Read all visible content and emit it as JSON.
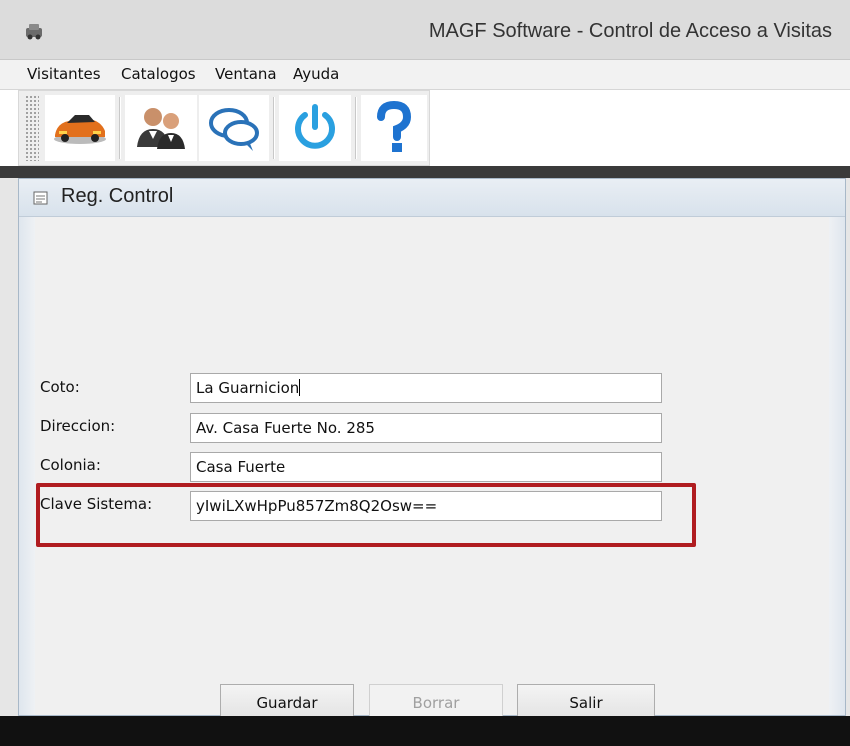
{
  "window": {
    "title": "MAGF Software - Control de Acceso a Visitas"
  },
  "menu": {
    "items": [
      "Visitantes",
      "Catalogos",
      "Ventana",
      "Ayuda"
    ]
  },
  "toolbar": {
    "buttons": [
      {
        "icon": "car-icon"
      },
      {
        "icon": "users-icon"
      },
      {
        "icon": "chat-bubbles-icon"
      },
      {
        "icon": "power-icon"
      },
      {
        "icon": "help-icon"
      }
    ]
  },
  "frame": {
    "title": "Reg. Control"
  },
  "form": {
    "fields": [
      {
        "label": "Coto:",
        "value": "La Guarnicion"
      },
      {
        "label": "Direccion:",
        "value": "Av. Casa Fuerte No. 285"
      },
      {
        "label": "Colonia:",
        "value": "Casa Fuerte"
      },
      {
        "label": "Clave Sistema:",
        "value": "yIwiLXwHpPu857Zm8Q2Osw=="
      }
    ]
  },
  "buttons": {
    "save": "Guardar",
    "delete": "Borrar",
    "exit": "Salir"
  },
  "colors": {
    "highlight": "#b01c20",
    "power_blue": "#2aa0e0",
    "help_blue": "#1e73d0"
  }
}
